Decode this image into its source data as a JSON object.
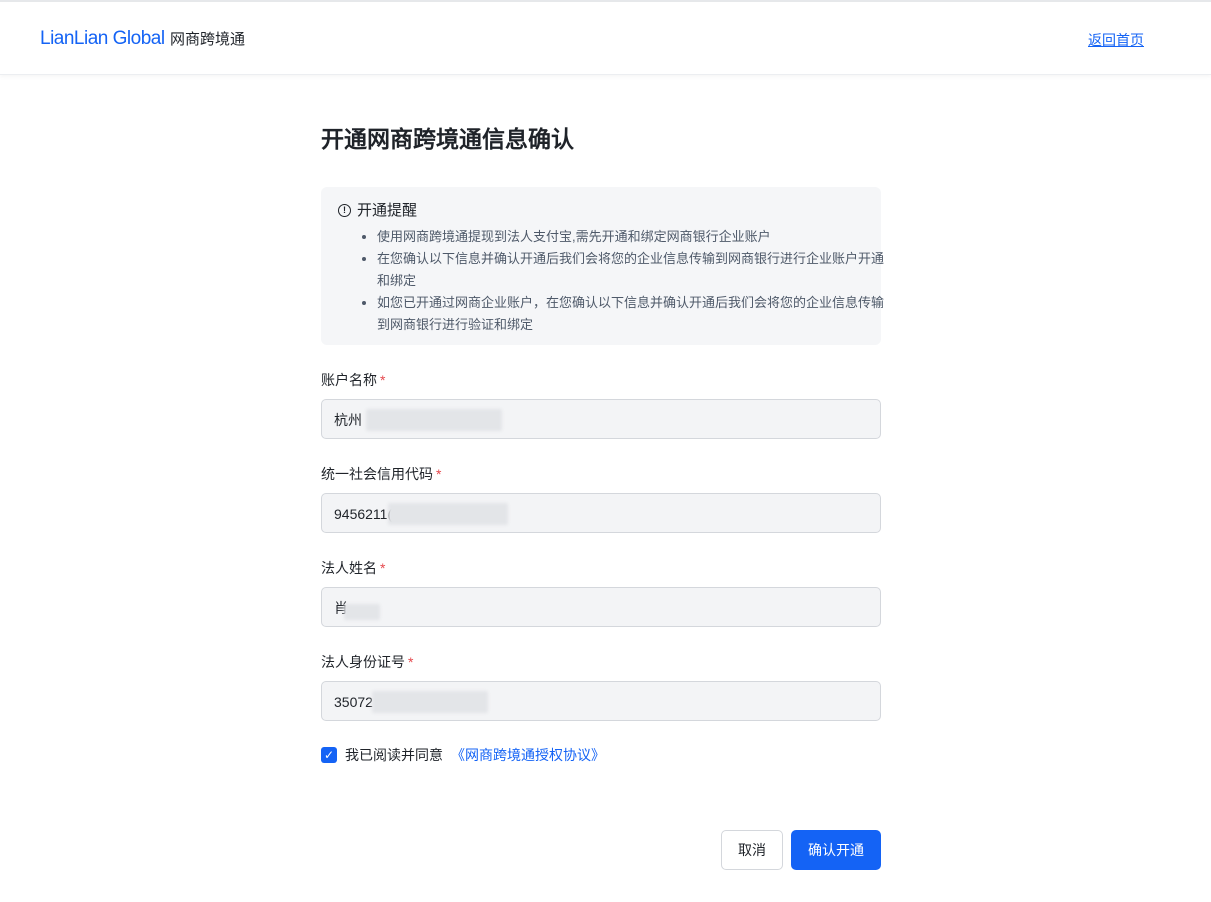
{
  "header": {
    "logo_text": "LianLian Global",
    "product_name": "网商跨境通",
    "home_link": "返回首页"
  },
  "page": {
    "title": "开通网商跨境通信息确认"
  },
  "notice": {
    "icon": "info-circle-icon",
    "title": "开通提醒",
    "items": [
      "使用网商跨境通提现到法人支付宝,需先开通和绑定网商银行企业账户",
      "在您确认以下信息并确认开通后我们会将您的企业信息传输到网商银行进行企业账户开通和绑定",
      "如您已开通过网商企业账户，在您确认以下信息并确认开通后我们会将您的企业信息传输到网商银行进行验证和绑定"
    ]
  },
  "form": {
    "required_mark": "*",
    "fields": [
      {
        "label": "账户名称",
        "value": "杭州"
      },
      {
        "label": "统一社会信用代码",
        "value": "9456211("
      },
      {
        "label": "法人姓名",
        "value": "肖"
      },
      {
        "label": "法人身份证号",
        "value": "35072"
      }
    ]
  },
  "agreement": {
    "checked": true,
    "text": "我已阅读并同意",
    "link": "《网商跨境通授权协议》"
  },
  "actions": {
    "cancel": "取消",
    "confirm": "确认开通"
  },
  "colors": {
    "brand": "#1463f5",
    "required": "#e5484d"
  }
}
